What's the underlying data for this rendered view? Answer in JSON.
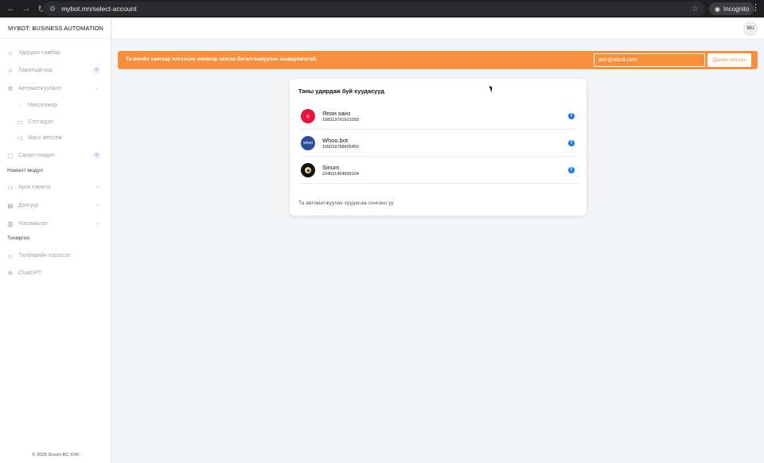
{
  "browser": {
    "url": "mybot.mn/select-account",
    "mode_label": "Incognito"
  },
  "sidebar": {
    "brand": "MYBOT: BUSINESS AUTOMATION",
    "items": [
      {
        "label": "Удирдах самбар",
        "icon": "home-icon"
      },
      {
        "label": "Харилцагчид",
        "icon": "user-icon",
        "badge": "0"
      },
      {
        "label": "Автоматжуулалт",
        "icon": "gear-icon"
      },
      {
        "label": "Мессенжер",
        "icon": "messenger-icon"
      },
      {
        "label": "Сэтгэгдэл",
        "icon": "comment-icon"
      },
      {
        "label": "Масс мессеж",
        "icon": "megaphone-icon"
      },
      {
        "label": "Санал гомдол",
        "icon": "chat-icon",
        "badge": "0"
      }
    ],
    "section_modules": "Нэмэлт модул",
    "module_items": [
      {
        "label": "Арга хэмжээ",
        "icon": "video-icon"
      },
      {
        "label": "Дэлгүүр",
        "icon": "store-icon"
      },
      {
        "label": "Нэхэмжлэл",
        "icon": "invoice-icon"
      }
    ],
    "section_settings": "Тохиргоо",
    "settings_items": [
      {
        "label": "Төлбөрийн хэрэгсэл",
        "icon": "wallet-icon"
      },
      {
        "label": "ChatGPT",
        "icon": "chatgpt-icon"
      }
    ],
    "copyright": "© 2025 Sinum BC XXK"
  },
  "header": {
    "avatar_initials": "MU"
  },
  "alert": {
    "message": "Та имэйл хаягаар илгээсэн линкээр хаягаа баталгаажуулах шаардлагатай.",
    "email_value": "abc@abcd.com",
    "resend_label": "Дахин илгээх",
    "color": "#f7903c"
  },
  "accounts_card": {
    "title": "Таны удирдаж буй хуудасууд",
    "accounts": [
      {
        "name": "Япон ханз",
        "id": "108313791621039",
        "avatar_color": "#e8123c",
        "platform_icon": "facebook-icon"
      },
      {
        "name": "Whoo.bot",
        "id": "105019788405450",
        "avatar_color": "#2c4d9a",
        "platform_icon": "facebook-icon"
      },
      {
        "name": "Sinum",
        "id": "104531964939104",
        "avatar_color": "#111111",
        "platform_icon": "facebook-icon"
      }
    ],
    "footer": "Та автоматжуулах хуудасаа сонгоно уу"
  }
}
